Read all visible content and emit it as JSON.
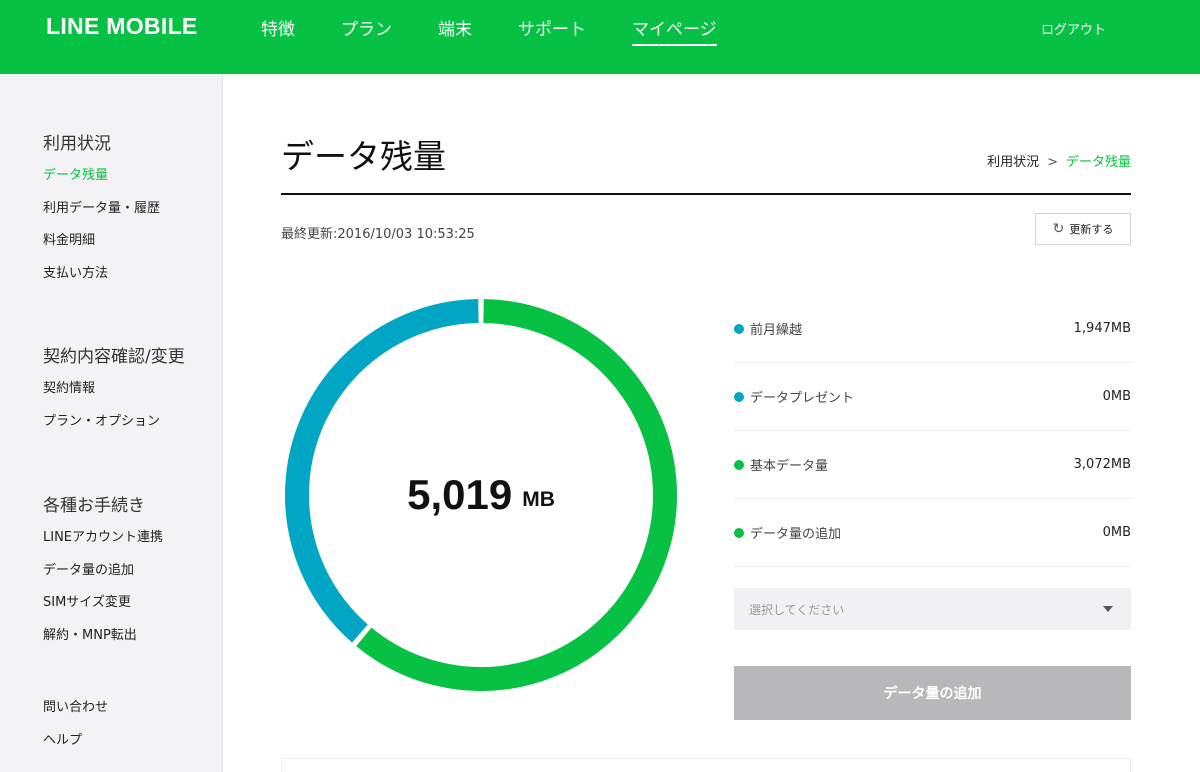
{
  "header": {
    "logo": "LINE MOBILE",
    "nav": [
      "特徴",
      "プラン",
      "端末",
      "サポート",
      "マイページ"
    ],
    "logout": "ログアウト"
  },
  "sidebar": {
    "groups": [
      {
        "title": "利用状況",
        "items": [
          "データ残量",
          "利用データ量・履歴",
          "料金明細",
          "支払い方法"
        ]
      },
      {
        "title": "契約内容確認/変更",
        "items": [
          "契約情報",
          "プラン・オプション"
        ]
      },
      {
        "title": "各種お手続き",
        "items": [
          "LINEアカウント連携",
          "データ量の追加",
          "SIMサイズ変更",
          "解約・MNP転出"
        ]
      },
      {
        "items": [
          "問い合わせ",
          "ヘルプ"
        ]
      }
    ]
  },
  "main": {
    "title": "データ残量",
    "breadcrumb": {
      "parent": "利用状況",
      "separator": ">",
      "current": "データ残量"
    },
    "last_updated": "最終更新:2016/10/03 10:53:25",
    "refresh_label": "更新する",
    "total_value": "5,019",
    "total_unit": "MB",
    "legend": [
      {
        "label": "前月繰越",
        "value": "1,947MB",
        "color": "#00a6c3"
      },
      {
        "label": "データプレゼント",
        "value": "0MB",
        "color": "#00a6c3"
      },
      {
        "label": "基本データ量",
        "value": "3,072MB",
        "color": "#06c143"
      },
      {
        "label": "データ量の追加",
        "value": "0MB",
        "color": "#06c143"
      }
    ],
    "select_placeholder": "選択してください",
    "add_button": "データ量の追加"
  },
  "chart_data": {
    "type": "pie",
    "categories": [
      "前月繰越",
      "データプレゼント",
      "基本データ量",
      "データ量の追加"
    ],
    "values": [
      1947,
      0,
      3072,
      0
    ],
    "colors": [
      "#00a6c3",
      "#00a6c3",
      "#06c143",
      "#06c143"
    ]
  },
  "colors": {
    "brand": "#06c143",
    "teal": "#00a6c3",
    "disabled": "#b8b8bb"
  }
}
